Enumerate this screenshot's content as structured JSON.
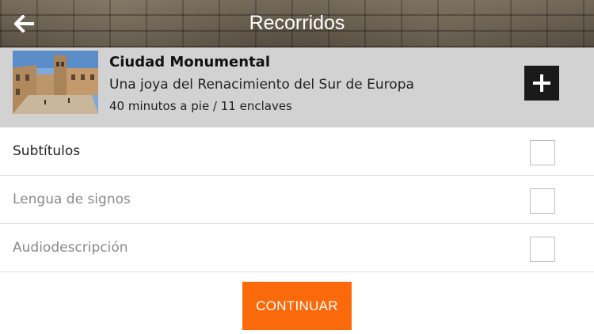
{
  "header": {
    "title": "Recorridos",
    "back_icon": "arrow-left-icon"
  },
  "route": {
    "name": "Ciudad Monumental",
    "subtitle": "Una joya del Renacimiento del Sur de Europa",
    "meta": "40 minutos a pie / 11 enclaves",
    "add_icon": "plus-icon"
  },
  "options": [
    {
      "label": "Subtítulos",
      "checked": false
    },
    {
      "label": "Lengua de signos",
      "checked": false
    },
    {
      "label": "Audiodescripción",
      "checked": false
    }
  ],
  "continue_label": "CONTINUAR",
  "colors": {
    "accent": "#fa6a0a",
    "card_bg": "#d2d2d2",
    "add_button_bg": "#1a1a1a"
  }
}
